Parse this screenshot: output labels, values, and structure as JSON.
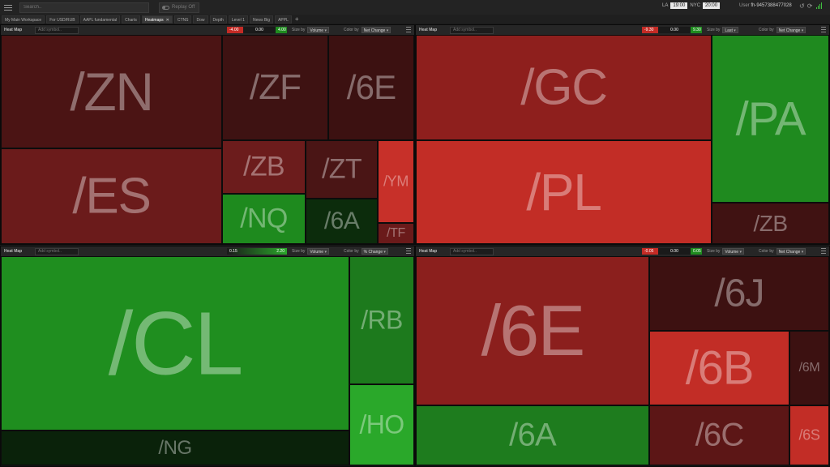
{
  "topbar": {
    "search_placeholder": "Search..",
    "replay_label": "Replay Off",
    "clocks": [
      {
        "label": "LA",
        "time": "19:00"
      },
      {
        "label": "NYC",
        "time": "20:00"
      }
    ],
    "user_label": "User",
    "user_id": "fh-9457388477028"
  },
  "tabs": [
    {
      "label": "My Main Workspace",
      "active": false
    },
    {
      "label": "For USD/RUB",
      "active": false
    },
    {
      "label": "AAPL fundamental",
      "active": false
    },
    {
      "label": "Charts",
      "active": false
    },
    {
      "label": "Heatmaps",
      "active": true
    },
    {
      "label": "CTNS",
      "active": false
    },
    {
      "label": "Dow",
      "active": false
    },
    {
      "label": "Depth",
      "active": false
    },
    {
      "label": "Level 1",
      "active": false
    },
    {
      "label": "News Big",
      "active": false
    },
    {
      "label": "APPL",
      "active": false
    }
  ],
  "colors": {
    "dark_red": "#4a1212",
    "red": "#6e1a1a",
    "bright_red": "#c42b25",
    "green": "#1f8c1f",
    "bright_green": "#2aa82a",
    "dark_green": "#0b2a0b"
  },
  "panels": [
    {
      "title": "Heat Map",
      "add_symbol_placeholder": "Add symbol..",
      "legend": [
        "-4.00",
        "0.00",
        "4.00"
      ],
      "size_by_label": "Size by",
      "size_by": "Volume",
      "color_by_label": "Color by",
      "color_by": "Net Change",
      "cells": [
        {
          "sym": "/ZN",
          "color": "#4b1414"
        },
        {
          "sym": "/ZF",
          "color": "#3e1212"
        },
        {
          "sym": "/6E",
          "color": "#3c1111"
        },
        {
          "sym": "/ES",
          "color": "#6b1b1b"
        },
        {
          "sym": "/ZB",
          "color": "#6c1c1c"
        },
        {
          "sym": "/ZT",
          "color": "#4a1515"
        },
        {
          "sym": "/YM",
          "color": "#c73029"
        },
        {
          "sym": "/NQ",
          "color": "#1e8a1e"
        },
        {
          "sym": "/6A",
          "color": "#0c2c0c"
        },
        {
          "sym": "/TF",
          "color": "#6a1a1a"
        }
      ]
    },
    {
      "title": "Heat Map",
      "add_symbol_placeholder": "Add symbol..",
      "legend": [
        "-9.30",
        "0.00",
        "9.30"
      ],
      "size_by_label": "Size by",
      "size_by": "Last",
      "color_by_label": "Color by",
      "color_by": "Net Change",
      "cells": [
        {
          "sym": "/GC",
          "color": "#8e1f1d"
        },
        {
          "sym": "/PA",
          "color": "#1f8a1f"
        },
        {
          "sym": "/PL",
          "color": "#c22d26"
        },
        {
          "sym": "/ZB",
          "color": "#401212"
        }
      ]
    },
    {
      "title": "Heat Map",
      "add_symbol_placeholder": "Add symbol..",
      "legend": [
        "0.15",
        "2.20"
      ],
      "size_by_label": "Size by",
      "size_by": "Volume",
      "color_by_label": "Color by",
      "color_by": "% Change",
      "cells": [
        {
          "sym": "/CL",
          "color": "#1f8e1f"
        },
        {
          "sym": "/RB",
          "color": "#1d7a1d"
        },
        {
          "sym": "/HO",
          "color": "#2aa82a"
        },
        {
          "sym": "/NG",
          "color": "#0a220a"
        }
      ]
    },
    {
      "title": "Heat Map",
      "add_symbol_placeholder": "Add symbol..",
      "legend": [
        "-0.05",
        "0.00",
        "0.05"
      ],
      "size_by_label": "Size by",
      "size_by": "Volume",
      "color_by_label": "Color by",
      "color_by": "Net Change",
      "cells": [
        {
          "sym": "/6E",
          "color": "#8b1f1d"
        },
        {
          "sym": "/6J",
          "color": "#3d1111"
        },
        {
          "sym": "/6B",
          "color": "#c22d26"
        },
        {
          "sym": "/6M",
          "color": "#3c1111"
        },
        {
          "sym": "/6A",
          "color": "#1e7c1e"
        },
        {
          "sym": "/6C",
          "color": "#5c1616"
        },
        {
          "sym": "/6S",
          "color": "#c22d26"
        }
      ]
    }
  ]
}
